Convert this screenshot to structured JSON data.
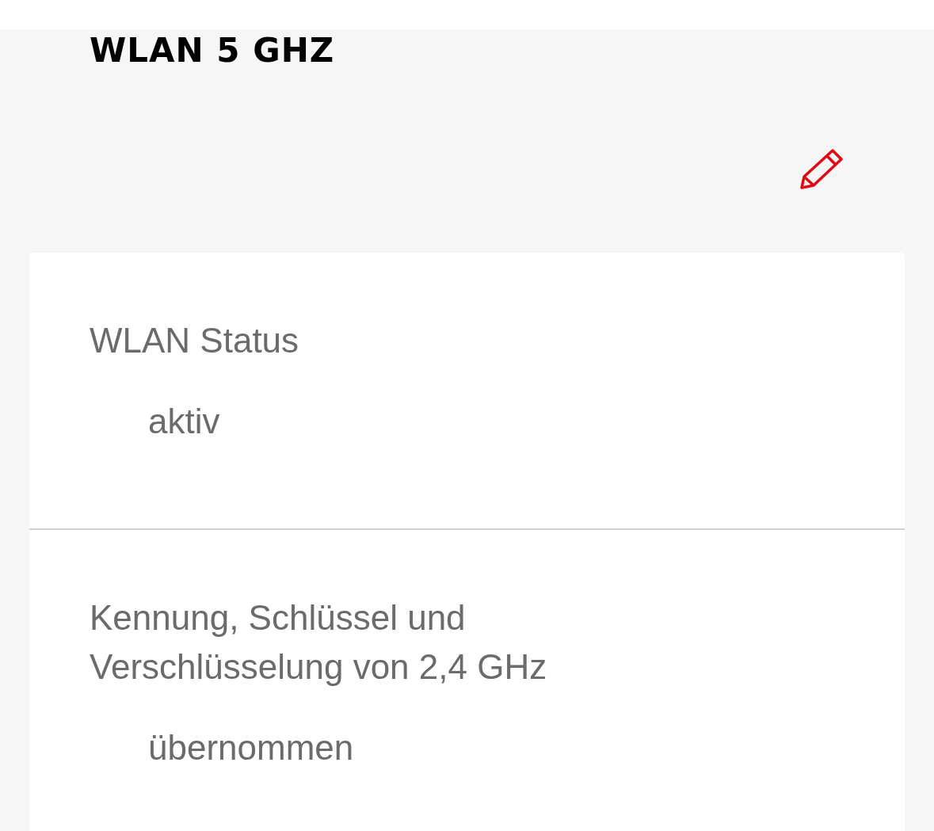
{
  "section": {
    "title": "WLAN 5 GHZ"
  },
  "rows": [
    {
      "label": "WLAN Status",
      "value": "aktiv"
    },
    {
      "label": "Kennung, Schlüssel und Verschlüsselung von 2,4 GHz",
      "value": "übernommen"
    }
  ]
}
